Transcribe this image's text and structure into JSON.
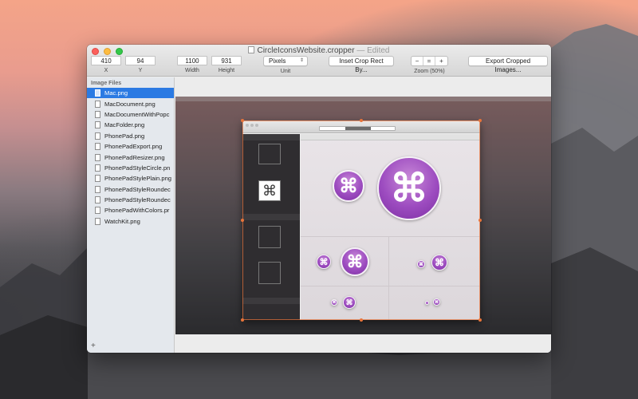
{
  "window": {
    "title": "CircleIconsWebsite.cropper",
    "edited": "— Edited"
  },
  "toolbar": {
    "x": {
      "value": "410",
      "label": "X"
    },
    "y": {
      "value": "94",
      "label": "Y"
    },
    "width": {
      "value": "1100",
      "label": "Width"
    },
    "height": {
      "value": "931",
      "label": "Height"
    },
    "unit": {
      "value": "Pixels",
      "label": "Unit"
    },
    "inset_button": "Inset Crop Rect By...",
    "zoom": {
      "minus": "−",
      "equal": "=",
      "plus": "+",
      "label": "Zoom (50%)"
    },
    "export_button": "Export Cropped Images..."
  },
  "sidebar": {
    "header": "Image Files",
    "files": [
      "Mac.png",
      "MacDocument.png",
      "MacDocumentWithPopc",
      "MacFolder.png",
      "PhonePad.png",
      "PhonePadExport.png",
      "PhonePadResizer.png",
      "PhonePadStyleCircle.pn",
      "PhonePadStylePlain.png",
      "PhonePadStyleRoundec",
      "PhonePadStyleRoundec",
      "PhonePadWithColors.pr",
      "WatchKit.png"
    ],
    "selected_index": 0,
    "add_label": "+"
  },
  "preview": {
    "cmd_glyph": "⌘",
    "accent": "#e8743a",
    "selection_color": "#2b7ae3",
    "icon_color": "#9d4cc0"
  }
}
